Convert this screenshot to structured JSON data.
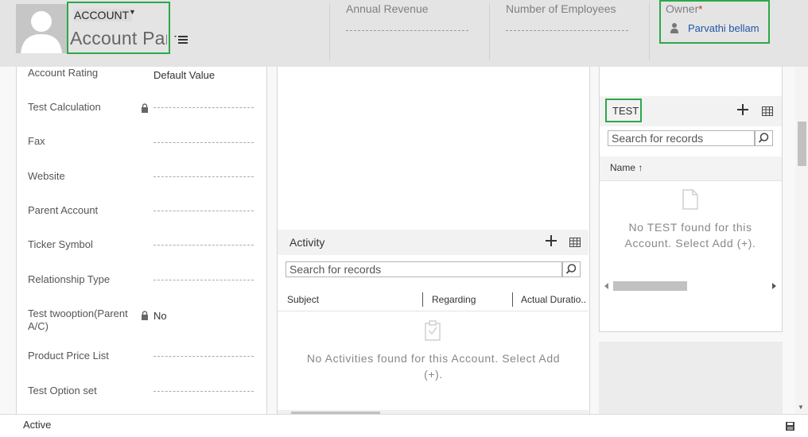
{
  "header": {
    "entity_label": "ACCOUNT",
    "record_name": "Account Par",
    "annual_revenue_label": "Annual Revenue",
    "employees_label": "Number of Employees",
    "owner_label": "Owner",
    "owner_required": "*",
    "owner_value": "Parvathi bellam"
  },
  "fields": [
    {
      "label": "Account Rating",
      "value": "Default Value",
      "locked": false
    },
    {
      "label": "Test Calculation",
      "value": "",
      "locked": true
    },
    {
      "label": "Fax",
      "value": "",
      "locked": false
    },
    {
      "label": "Website",
      "value": "",
      "locked": false
    },
    {
      "label": "Parent Account",
      "value": "",
      "locked": false
    },
    {
      "label": "Ticker Symbol",
      "value": "",
      "locked": false
    },
    {
      "label": "Relationship Type",
      "value": "",
      "locked": false
    },
    {
      "label": "Test twooption(Parent A/C)",
      "value": "No",
      "locked": true
    },
    {
      "label": "Product Price List",
      "value": "",
      "locked": false
    },
    {
      "label": "Test Option set",
      "value": "",
      "locked": false
    }
  ],
  "activity": {
    "title": "Activity",
    "search_placeholder": "Search for records",
    "columns": [
      "Subject",
      "Regarding",
      "Actual Duratio.."
    ],
    "empty_message": "No Activities found for this Account. Select Add (+)."
  },
  "test_grid": {
    "title": "TEST",
    "search_placeholder": "Search for records",
    "column_name": "Name",
    "empty_message": "No TEST found for this Account. Select Add (+)."
  },
  "status": {
    "text": "Active"
  },
  "icons": {
    "avatar": "person-silhouette-icon",
    "nav": "hamburger-menu-icon",
    "owner": "user-icon",
    "lock": "lock-icon",
    "add": "plus-icon",
    "grid": "grid-view-icon",
    "search": "magnifier-icon",
    "sort": "arrow-up-icon",
    "save": "floppy-disk-icon"
  },
  "colors": {
    "highlight": "#2ca84a",
    "link": "#2156a5",
    "required": "#d81b1b"
  }
}
